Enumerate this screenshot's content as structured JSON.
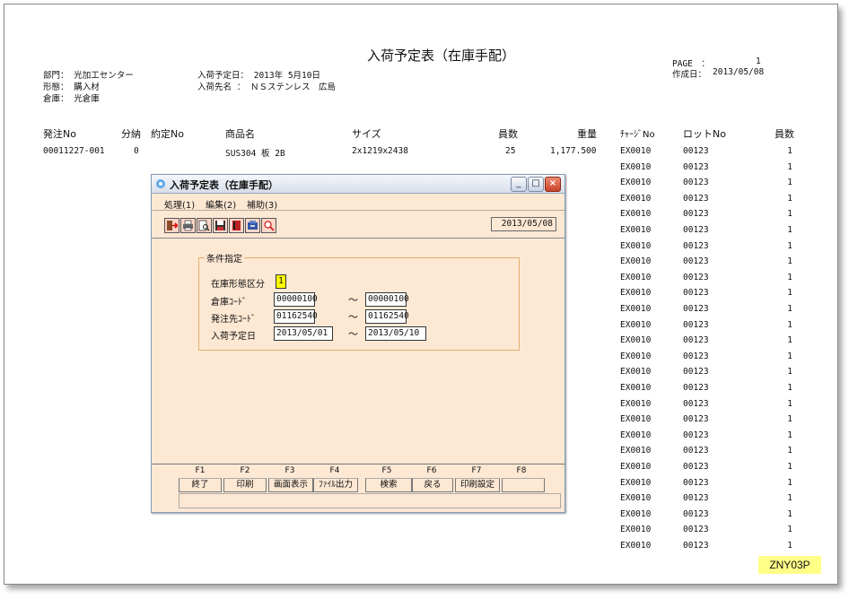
{
  "report": {
    "title": "入荷予定表（在庫手配）",
    "page_label": "PAGE　：",
    "page_value": "1",
    "created_label": "作成日：",
    "created_value": "2013/05/08",
    "dept": "部門： 光加工センター",
    "form": "形態： 購入材",
    "warehouse": "倉庫： 光倉庫",
    "arrival_date": "入荷予定日： 2013年 5月10日",
    "arrival_dest": "入荷先名 ： ＮＳステンレス　広島",
    "columns": {
      "order_no": "発注No",
      "split": "分納",
      "contract_no": "約定No",
      "product": "商品名",
      "size": "サイズ",
      "count": "員数",
      "weight": "重量",
      "charge_no": "ﾁｬｰｼﾞNo",
      "lot_no": "ロットNo",
      "count2": "員数"
    },
    "row": {
      "order_no": "00011227-001",
      "split": "0",
      "product": "SUS304 板 2B",
      "size": "2x1219x2438",
      "count": "25",
      "weight": "1,177.500"
    },
    "lots": [
      {
        "charge": "EX0010",
        "lot": "00123",
        "qty": "1"
      },
      {
        "charge": "EX0010",
        "lot": "00123",
        "qty": "1"
      },
      {
        "charge": "EX0010",
        "lot": "00123",
        "qty": "1"
      },
      {
        "charge": "EX0010",
        "lot": "00123",
        "qty": "1"
      },
      {
        "charge": "EX0010",
        "lot": "00123",
        "qty": "1"
      },
      {
        "charge": "EX0010",
        "lot": "00123",
        "qty": "1"
      },
      {
        "charge": "EX0010",
        "lot": "00123",
        "qty": "1"
      },
      {
        "charge": "EX0010",
        "lot": "00123",
        "qty": "1"
      },
      {
        "charge": "EX0010",
        "lot": "00123",
        "qty": "1"
      },
      {
        "charge": "EX0010",
        "lot": "00123",
        "qty": "1"
      },
      {
        "charge": "EX0010",
        "lot": "00123",
        "qty": "1"
      },
      {
        "charge": "EX0010",
        "lot": "00123",
        "qty": "1"
      },
      {
        "charge": "EX0010",
        "lot": "00123",
        "qty": "1"
      },
      {
        "charge": "EX0010",
        "lot": "00123",
        "qty": "1"
      },
      {
        "charge": "EX0010",
        "lot": "00123",
        "qty": "1"
      },
      {
        "charge": "EX0010",
        "lot": "00123",
        "qty": "1"
      },
      {
        "charge": "EX0010",
        "lot": "00123",
        "qty": "1"
      },
      {
        "charge": "EX0010",
        "lot": "00123",
        "qty": "1"
      },
      {
        "charge": "EX0010",
        "lot": "00123",
        "qty": "1"
      },
      {
        "charge": "EX0010",
        "lot": "00123",
        "qty": "1"
      },
      {
        "charge": "EX0010",
        "lot": "00123",
        "qty": "1"
      },
      {
        "charge": "EX0010",
        "lot": "00123",
        "qty": "1"
      },
      {
        "charge": "EX0010",
        "lot": "00123",
        "qty": "1"
      },
      {
        "charge": "EX0010",
        "lot": "00123",
        "qty": "1"
      },
      {
        "charge": "EX0010",
        "lot": "00123",
        "qty": "1"
      },
      {
        "charge": "EX0010",
        "lot": "00123",
        "qty": "1"
      }
    ]
  },
  "badge": "ZNY03P",
  "dialog": {
    "title": "入荷予定表（在庫手配）",
    "menu": [
      "処理(1)",
      "編集(2)",
      "補助(3)"
    ],
    "toolbar_icons": [
      "exit-icon",
      "print-icon",
      "preview-icon",
      "save-icon",
      "book-icon",
      "settings-icon",
      "search-icon"
    ],
    "date": "2013/05/08",
    "group_title": "条件指定",
    "fields": {
      "stock_type_label": "在庫形態区分",
      "stock_type_value": "1",
      "warehouse_label": "倉庫ｺｰﾄﾞ",
      "warehouse_from": "00000100",
      "warehouse_to": "00000100",
      "supplier_label": "発注先ｺｰﾄﾞ",
      "supplier_from": "01162540",
      "supplier_to": "01162540",
      "date_label": "入荷予定日",
      "date_from": "2013/05/01",
      "date_to": "2013/05/10",
      "tilde": "～"
    },
    "fkeys": [
      {
        "key": "F1",
        "label": "終了"
      },
      {
        "key": "F2",
        "label": "印刷"
      },
      {
        "key": "F3",
        "label": "画面表示"
      },
      {
        "key": "F4",
        "label": "ﾌｧｲﾙ出力"
      },
      {
        "key": "F5",
        "label": "検索"
      },
      {
        "key": "F6",
        "label": "戻る"
      },
      {
        "key": "F7",
        "label": "印刷設定"
      },
      {
        "key": "F8",
        "label": ""
      }
    ]
  }
}
